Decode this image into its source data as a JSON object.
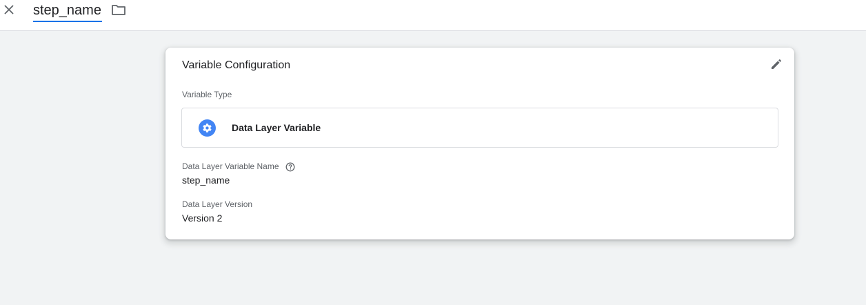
{
  "header": {
    "close_icon": "close-icon",
    "name_value": "step_name",
    "folder_icon": "folder-icon"
  },
  "card": {
    "title": "Variable Configuration",
    "edit_icon": "pencil-icon",
    "variable_type_label": "Variable Type",
    "variable_type": {
      "icon": "gear-icon",
      "icon_color": "#4285f4",
      "name": "Data Layer Variable"
    },
    "dlv_name_label": "Data Layer Variable Name",
    "dlv_name_value": "step_name",
    "dlv_version_label": "Data Layer Version",
    "dlv_version_value": "Version 2"
  },
  "colors": {
    "accent": "#1a73e8",
    "background": "#f1f3f4"
  }
}
